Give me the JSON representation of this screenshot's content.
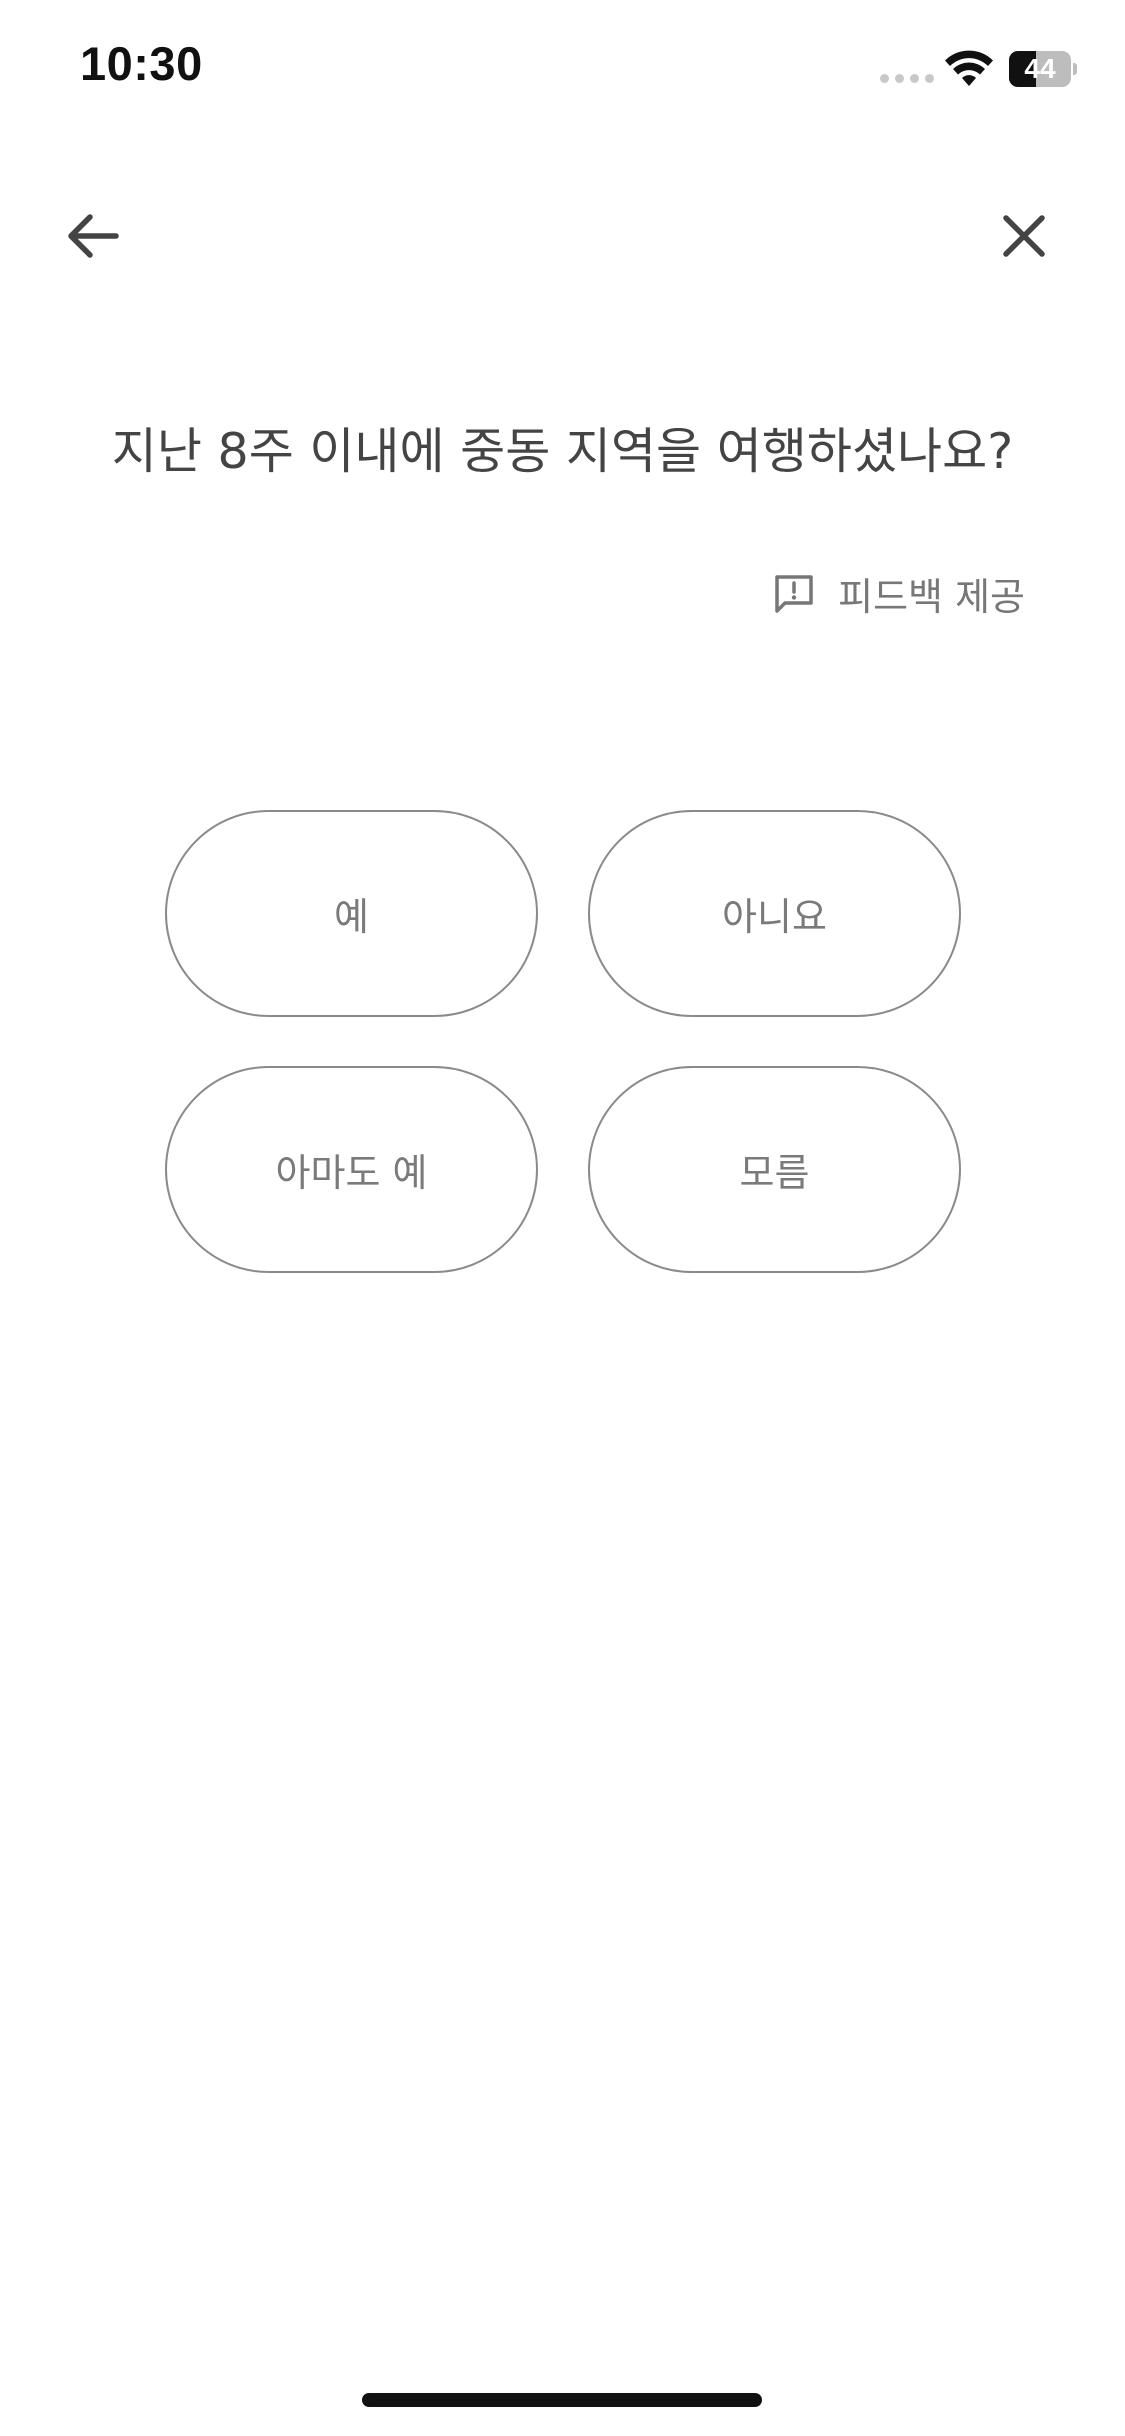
{
  "status_bar": {
    "time": "10:30",
    "battery_level": "44",
    "battery_fraction": 0.44,
    "wifi_icon": "wifi-icon",
    "signal_icon": "cellular-signal-icon"
  },
  "nav": {
    "back_icon": "arrow-left-icon",
    "close_icon": "close-icon"
  },
  "question": {
    "text": "지난 8주 이내에 중동 지역을 여행하셨나요?"
  },
  "feedback": {
    "icon": "feedback-icon",
    "label": "피드백 제공"
  },
  "options": [
    {
      "label": "예"
    },
    {
      "label": "아니요"
    },
    {
      "label": "아마도 예"
    },
    {
      "label": "모름"
    }
  ],
  "colors": {
    "text_primary": "#444444",
    "text_secondary": "#777777",
    "option_border": "#8a8a8a",
    "background": "#ffffff"
  }
}
